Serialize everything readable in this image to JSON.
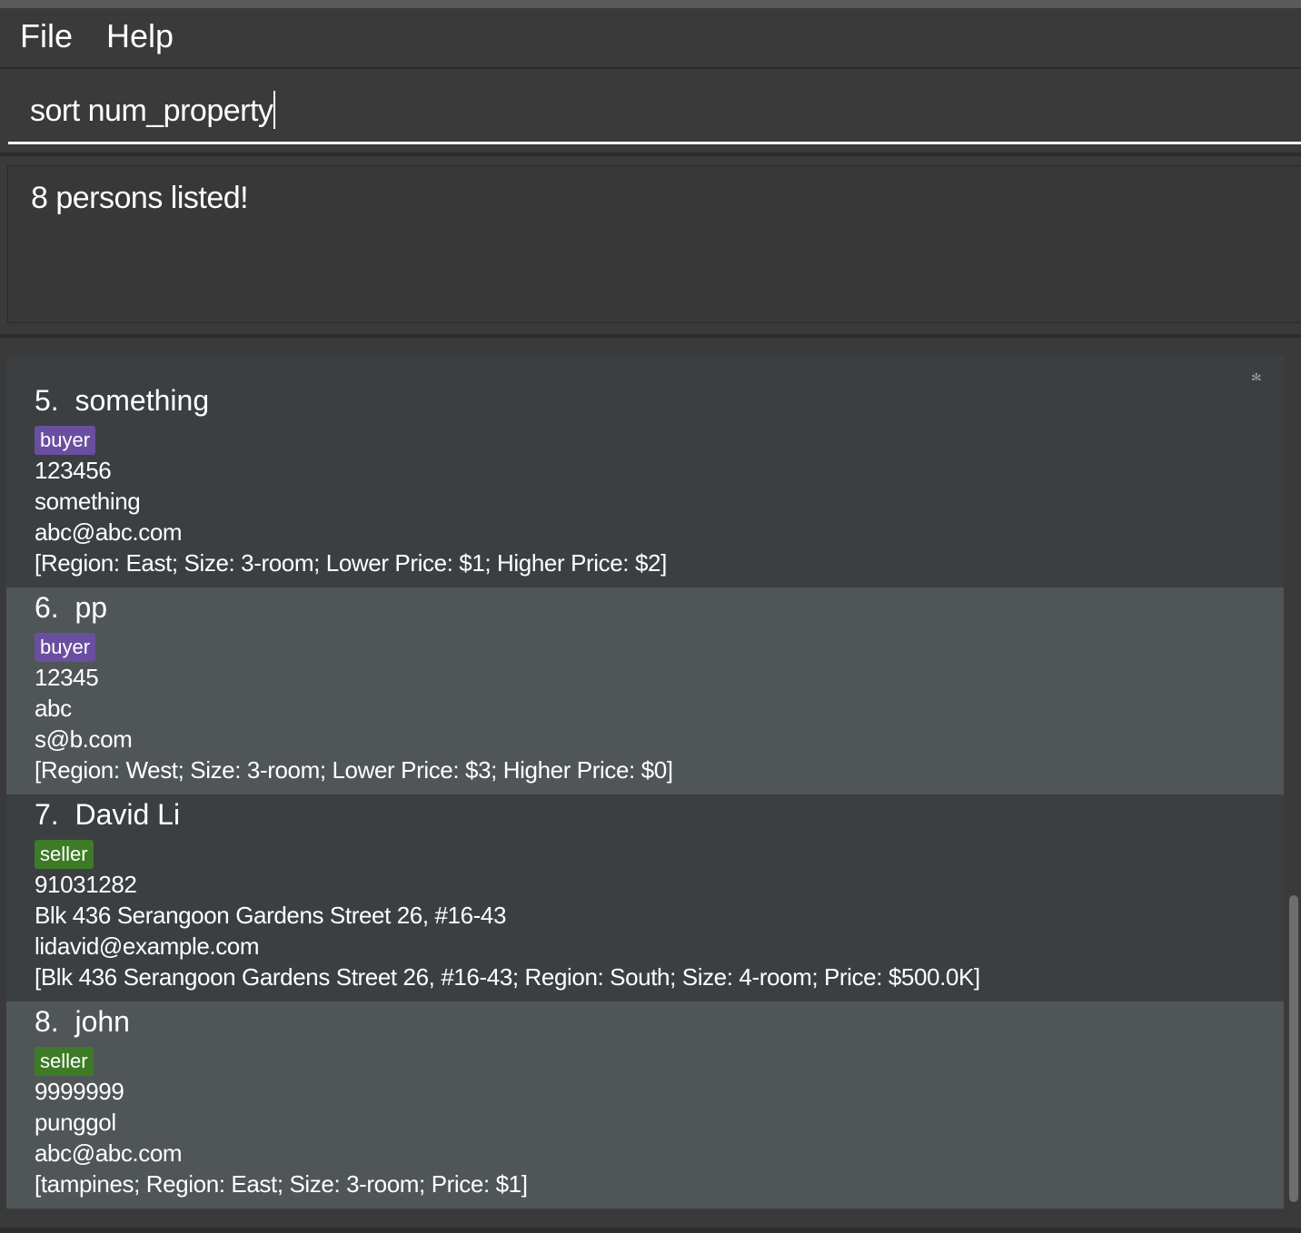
{
  "menu": {
    "file_label": "File",
    "help_label": "Help"
  },
  "command": {
    "value": "sort num_property"
  },
  "result": {
    "message": "8 persons listed!"
  },
  "persons": [
    {
      "name": "5.  something",
      "tag": "buyer",
      "phone": "123456",
      "address": "something",
      "email": "abc@abc.com",
      "property": "[Region: East; Size: 3-room; Lower Price: $1; Higher Price: $2]"
    },
    {
      "name": "6.  pp",
      "tag": "buyer",
      "phone": "12345",
      "address": "abc",
      "email": "s@b.com",
      "property": "[Region: West; Size: 3-room; Lower Price: $3; Higher Price: $0]"
    },
    {
      "name": "7.  David Li",
      "tag": "seller",
      "phone": "91031282",
      "address": "Blk 436 Serangoon Gardens Street 26, #16-43",
      "email": "lidavid@example.com",
      "property": "[Blk 436 Serangoon Gardens Street 26, #16-43; Region: South; Size: 4-room; Price: $500.0K]"
    },
    {
      "name": "8.  john",
      "tag": "seller",
      "phone": "9999999",
      "address": "punggol",
      "email": "abc@abc.com",
      "property": "[tampines; Region: East; Size: 3-room; Price: $1]"
    }
  ],
  "colors": {
    "buyer_tag": "#6a4fa0",
    "seller_tag": "#3e7b27",
    "card_even": "#3c3f41",
    "card_odd": "#505558"
  }
}
